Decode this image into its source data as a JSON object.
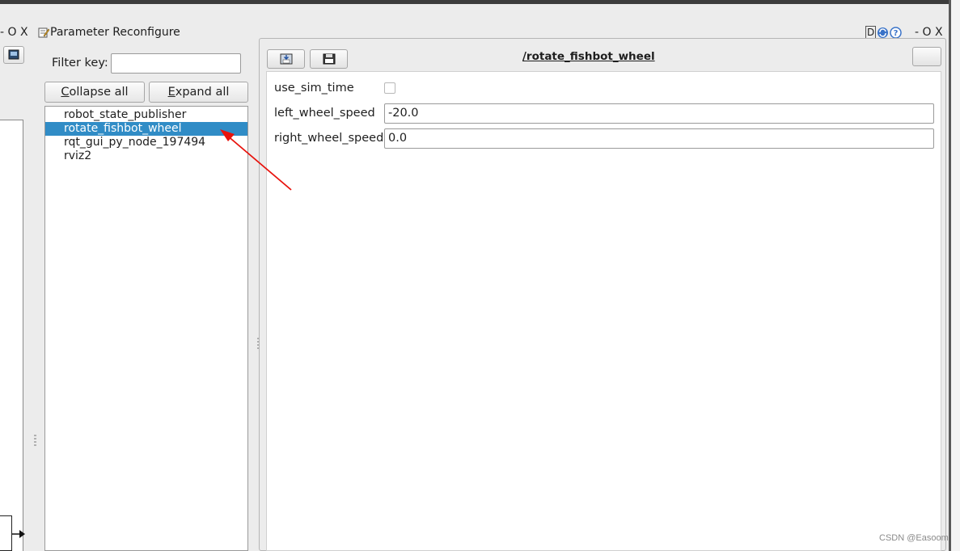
{
  "window": {
    "left_controls": "- O X",
    "title": "Parameter Reconfigure",
    "right_controls": "- O X",
    "help_icons": [
      "D",
      "refresh-icon",
      "help-icon"
    ]
  },
  "filter": {
    "label": "Filter key:",
    "value": ""
  },
  "buttons": {
    "collapse_first": "C",
    "collapse_rest": "ollapse all",
    "expand_first": "E",
    "expand_rest": "xpand all"
  },
  "nodes": {
    "items": [
      {
        "label": "robot_state_publisher",
        "selected": false
      },
      {
        "label": "rotate_fishbot_wheel",
        "selected": true
      },
      {
        "label": "rqt_gui_py_node_197494",
        "selected": false
      },
      {
        "label": "rviz2",
        "selected": false
      }
    ]
  },
  "param_panel": {
    "node_name": "/rotate_fishbot_wheel",
    "params": [
      {
        "name": "use_sim_time",
        "type": "bool",
        "value": false
      },
      {
        "name": "left_wheel_speed",
        "type": "double",
        "value": "-20.0"
      },
      {
        "name": "right_wheel_speed",
        "type": "double",
        "value": "0.0"
      }
    ]
  },
  "annotation": {
    "color": "#e8120c"
  },
  "colors": {
    "selection": "#308cc6"
  },
  "watermark": "CSDN @Easoom"
}
